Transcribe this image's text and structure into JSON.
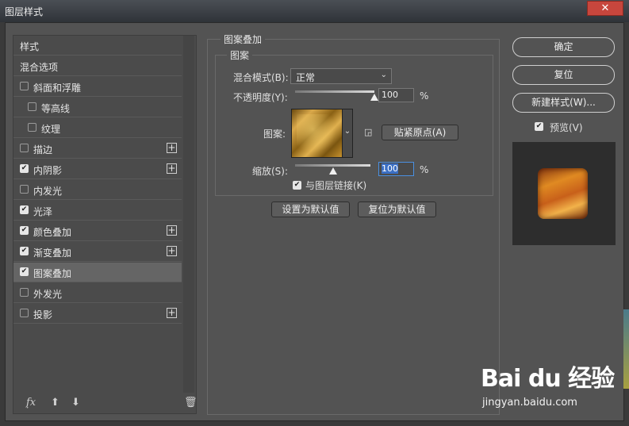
{
  "window": {
    "title": "图层样式",
    "close_glyph": "✕"
  },
  "left_panel": {
    "items": [
      {
        "label": "样式",
        "checkbox": false,
        "checked": false,
        "plus": false,
        "indent": 0,
        "selected": false
      },
      {
        "label": "混合选项",
        "checkbox": false,
        "checked": false,
        "plus": false,
        "indent": 0,
        "selected": false
      },
      {
        "label": "斜面和浮雕",
        "checkbox": true,
        "checked": false,
        "plus": false,
        "indent": 0,
        "selected": false
      },
      {
        "label": "等高线",
        "checkbox": true,
        "checked": false,
        "plus": false,
        "indent": 1,
        "selected": false
      },
      {
        "label": "纹理",
        "checkbox": true,
        "checked": false,
        "plus": false,
        "indent": 1,
        "selected": false
      },
      {
        "label": "描边",
        "checkbox": true,
        "checked": false,
        "plus": true,
        "indent": 0,
        "selected": false
      },
      {
        "label": "内阴影",
        "checkbox": true,
        "checked": true,
        "plus": true,
        "indent": 0,
        "selected": false
      },
      {
        "label": "内发光",
        "checkbox": true,
        "checked": false,
        "plus": false,
        "indent": 0,
        "selected": false
      },
      {
        "label": "光泽",
        "checkbox": true,
        "checked": true,
        "plus": false,
        "indent": 0,
        "selected": false
      },
      {
        "label": "颜色叠加",
        "checkbox": true,
        "checked": true,
        "plus": true,
        "indent": 0,
        "selected": false
      },
      {
        "label": "渐变叠加",
        "checkbox": true,
        "checked": true,
        "plus": true,
        "indent": 0,
        "selected": false
      },
      {
        "label": "图案叠加",
        "checkbox": true,
        "checked": true,
        "plus": false,
        "indent": 0,
        "selected": true
      },
      {
        "label": "外发光",
        "checkbox": true,
        "checked": false,
        "plus": false,
        "indent": 0,
        "selected": false
      },
      {
        "label": "投影",
        "checkbox": true,
        "checked": false,
        "plus": true,
        "indent": 0,
        "selected": false
      }
    ],
    "fx_label": "fx",
    "fx_sub": "."
  },
  "pattern_overlay": {
    "section_title": "图案叠加",
    "group_title": "图案",
    "blend_mode_label": "混合模式(B):",
    "blend_mode_value": "正常",
    "opacity_label": "不透明度(Y):",
    "opacity_value": "100",
    "opacity_unit": "%",
    "opacity_level": 1.0,
    "pattern_label": "图案:",
    "snap_origin_button": "贴紧原点(A)",
    "scale_label": "缩放(S):",
    "scale_value": "100",
    "scale_unit": "%",
    "scale_level": 0.5,
    "link_with_layer_label": "与图层链接(K)",
    "link_with_layer_checked": true,
    "set_default_button": "设置为默认值",
    "reset_default_button": "复位为默认值"
  },
  "right_buttons": {
    "ok": "确定",
    "reset": "复位",
    "new_style": "新建样式(W)...",
    "preview_label": "预览(V)",
    "preview_checked": true
  },
  "watermark": {
    "brand": "Bai du 经验",
    "url": "jingyan.baidu.com"
  },
  "colors": {
    "dialog_bg": "#535353",
    "selected_row": "#656565",
    "accent": "#4a90e2"
  }
}
